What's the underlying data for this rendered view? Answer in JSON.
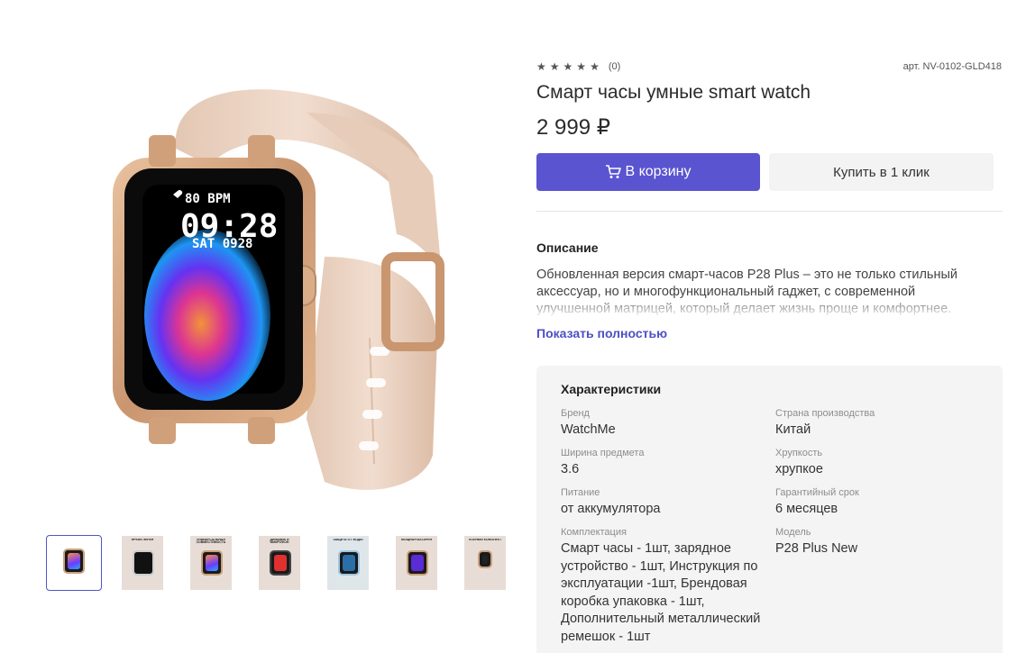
{
  "product": {
    "rating_stars": 5,
    "rating_count": "(0)",
    "sku": "арт. NV-0102-GLD418",
    "title": "Смарт часы умные smart watch",
    "price": "2 999 ₽"
  },
  "watch_face": {
    "bpm": "80  BPM",
    "time": "09:28",
    "date": "SAT 0928"
  },
  "buttons": {
    "cart_label": "В корзину",
    "oneclick_label": "Купить в 1 клик"
  },
  "description": {
    "title": "Описание",
    "text": "Обновленная версия смарт-часов P28 Plus – это не только стильный аксессуар, но и многофункциональный гаджет, с современной улучшенной матрицей, который делает жизнь проще и комфортнее.",
    "show_more": "Показать полностью"
  },
  "thumbnails": [
    {
      "caption": ""
    },
    {
      "caption": "ЯРКИЙ ЭКРАН"
    },
    {
      "caption": "УНИВЕРСАЛЬНАЯ СОВМЕСТИМОСТЬ"
    },
    {
      "caption": "ДИНАМИК И МИКРОФОН"
    },
    {
      "caption": "ЗАЩИТА ОТ ВОДЫ"
    },
    {
      "caption": "МОЩНАЯ БАТАРЕЯ"
    },
    {
      "caption": "ПОЛНЫЙ КОМПЛЕКТ"
    }
  ],
  "specs": {
    "title": "Характеристики",
    "items": [
      {
        "label": "Бренд",
        "value": "WatchMe"
      },
      {
        "label": "Страна производства",
        "value": "Китай"
      },
      {
        "label": "Ширина предмета",
        "value": "3.6"
      },
      {
        "label": "Хрупкость",
        "value": "хрупкое"
      },
      {
        "label": "Питание",
        "value": "от аккумулятора"
      },
      {
        "label": "Гарантийный срок",
        "value": "6 месяцев"
      },
      {
        "label": "Комплектация",
        "value": "Смарт часы - 1шт, зарядное устройство - 1шт, Инструкция по эксплуатации -1шт, Брендовая коробка упаковка - 1шт, Дополнительный металлический ремешок - 1шт"
      },
      {
        "label": "Модель",
        "value": "P28 Plus New"
      }
    ]
  },
  "colors": {
    "accent": "#5a54d1",
    "link": "#4c4fc4",
    "strap": "#ecd5c4",
    "case_gold": "#d3a37e"
  }
}
